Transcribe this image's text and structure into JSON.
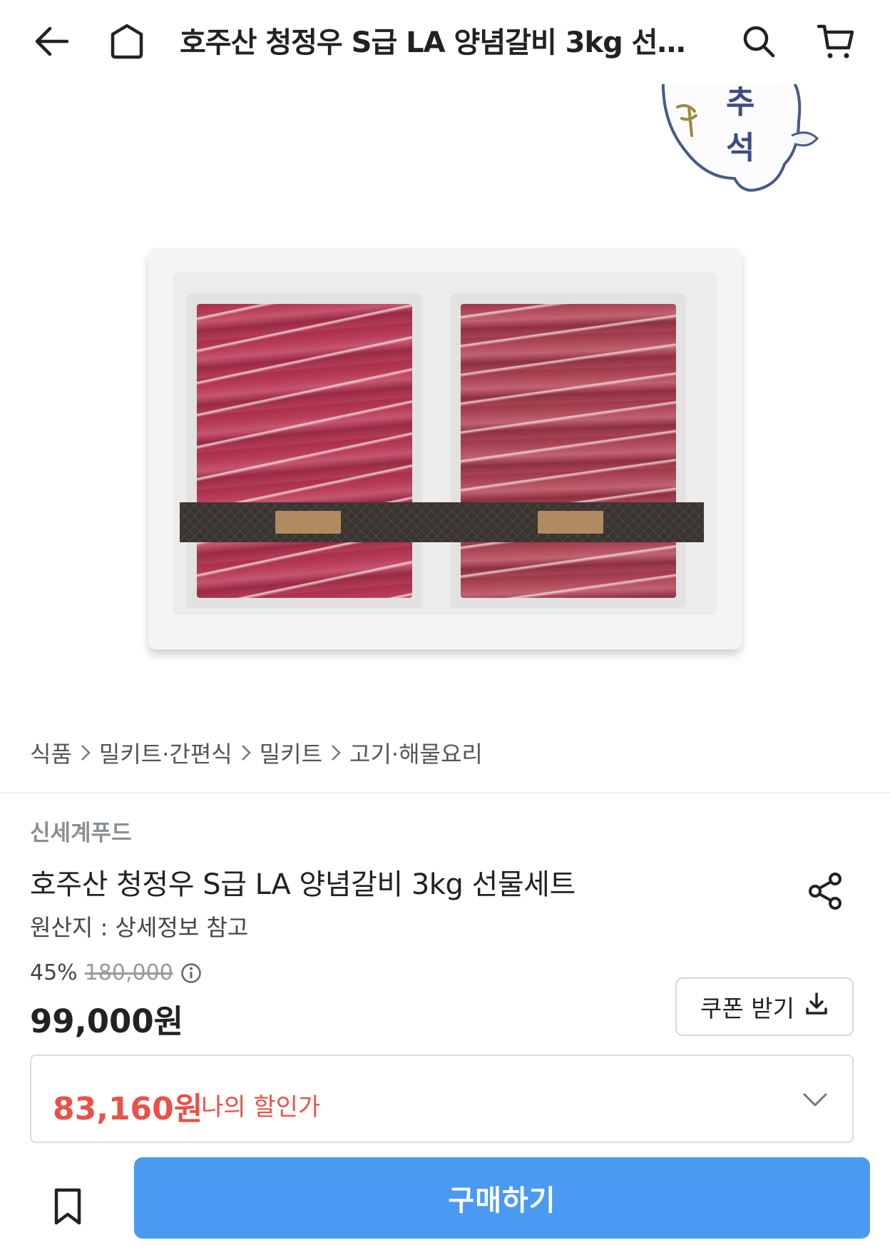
{
  "header": {
    "title": "호주산 청정우 S급 LA 양념갈비 3kg 선물세트",
    "icons": [
      "back-icon",
      "home-icon",
      "search-icon",
      "cart-icon"
    ]
  },
  "image": {
    "badge_text_1": "추",
    "badge_text_2": "석"
  },
  "breadcrumb": {
    "items": [
      "식품",
      "밀키트·간편식",
      "밀키트",
      "고기·해물요리"
    ]
  },
  "product": {
    "brand": "신세계푸드",
    "title": "호주산 청정우 S급 LA 양념갈비 3kg 선물세트",
    "origin": "원산지 : 상세정보 참고",
    "discount_rate": "45%",
    "original_price": "180,000",
    "price": "99,000원",
    "coupon_label": "쿠폰 받기",
    "my_price": "83,160원",
    "my_price_label": "나의 할인가"
  },
  "actions": {
    "buy_label": "구매하기"
  },
  "colors": {
    "accent_blue": "#4a9af2",
    "discount_red": "#e8524a",
    "brand_gray": "#8a8f96"
  }
}
